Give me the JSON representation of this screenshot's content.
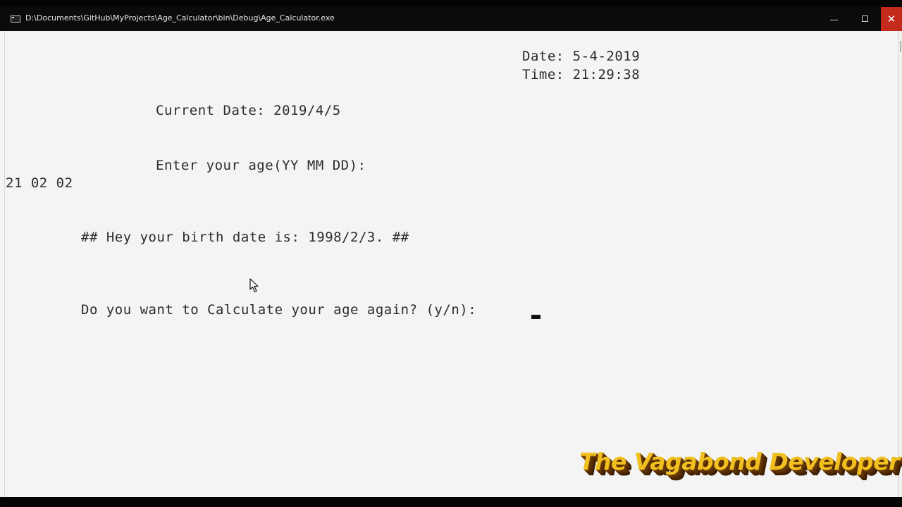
{
  "window": {
    "title": "D:\\Documents\\GitHub\\MyProjects\\Age_Calculator\\bin\\Debug\\Age_Calculator.exe",
    "minimize_icon": "minimize-icon",
    "maximize_icon": "maximize-icon",
    "close_glyph": "✕"
  },
  "console": {
    "date_line": "Date: 5-4-2019",
    "time_line": "Time: 21:29:38",
    "current_date_line": "Current Date: 2019/4/5",
    "prompt_age_line": "Enter your age(YY MM DD):",
    "user_input_line": "21 02 02",
    "birth_date_line": "## Hey your birth date is: 1998/2/3. ##",
    "again_prompt_line": "Do you want to Calculate your age again? (y/n):"
  },
  "watermark": {
    "text": "The Vagabond Developer"
  },
  "colors": {
    "titlebar": "#0b0b0b",
    "console_bg": "#f4f4f4",
    "console_text": "#2c2c2c",
    "close_button": "#c42b1c",
    "watermark_fill": "#f0c020",
    "watermark_shadow": "#5b3005"
  }
}
